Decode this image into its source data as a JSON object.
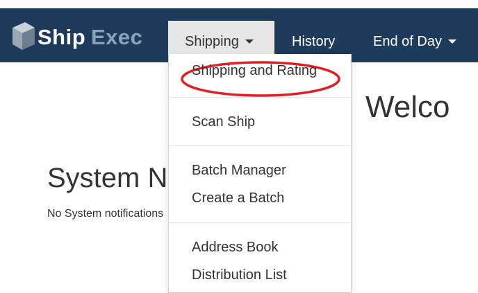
{
  "brand": {
    "name_part1": "Ship",
    "name_part2": "Exec"
  },
  "nav": {
    "shipping_label": "Shipping",
    "history_label": "History",
    "eod_label": "End of Day"
  },
  "dropdown": {
    "items": [
      "Shipping and Rating",
      "Scan Ship",
      "Batch Manager",
      "Create a Batch",
      "Address Book",
      "Distribution List"
    ]
  },
  "main": {
    "welcome": "Welco",
    "system_heading": "System N",
    "notifications_text": "No System notifications"
  },
  "colors": {
    "navbar": "#1f3b5c",
    "active_tab": "#e7e7e7",
    "highlight_ring": "#e01e25"
  }
}
